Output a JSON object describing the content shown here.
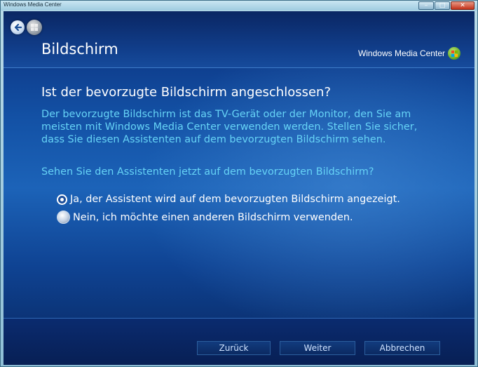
{
  "window": {
    "title": "Windows Media Center",
    "controls": {
      "minimize": "–",
      "maximize": "□",
      "close": "✕"
    }
  },
  "header": {
    "page_title": "Bildschirm",
    "brand_text": "Windows Media Center",
    "icons": {
      "back": "back-arrow-icon",
      "start": "windows-start-orb-icon",
      "brand_logo": "windows-flag-logo-icon"
    }
  },
  "main": {
    "question": "Ist der bevorzugte Bildschirm angeschlossen?",
    "description_lines": [
      "Der bevorzugte Bildschirm ist das TV-Gerät oder der Monitor, den Sie am",
      "meisten mit Windows Media Center verwenden werden. Stellen Sie sicher,",
      "dass Sie diesen Assistenten auf dem bevorzugten Bildschirm sehen."
    ],
    "prompt": "Sehen Sie den Assistenten jetzt auf dem bevorzugten Bildschirm?",
    "options": [
      {
        "label": "Ja, der Assistent wird auf dem bevorzugten Bildschirm angezeigt.",
        "selected": true
      },
      {
        "label": "Nein, ich möchte einen anderen Bildschirm verwenden.",
        "selected": false
      }
    ]
  },
  "footer": {
    "back_label": "Zurück",
    "next_label": "Weiter",
    "cancel_label": "Abbrechen"
  },
  "colors": {
    "background_dark": "#0a2c78",
    "background_mid": "#1c63b8",
    "accent_text": "#66d3f6",
    "primary_text": "#ffffff"
  }
}
